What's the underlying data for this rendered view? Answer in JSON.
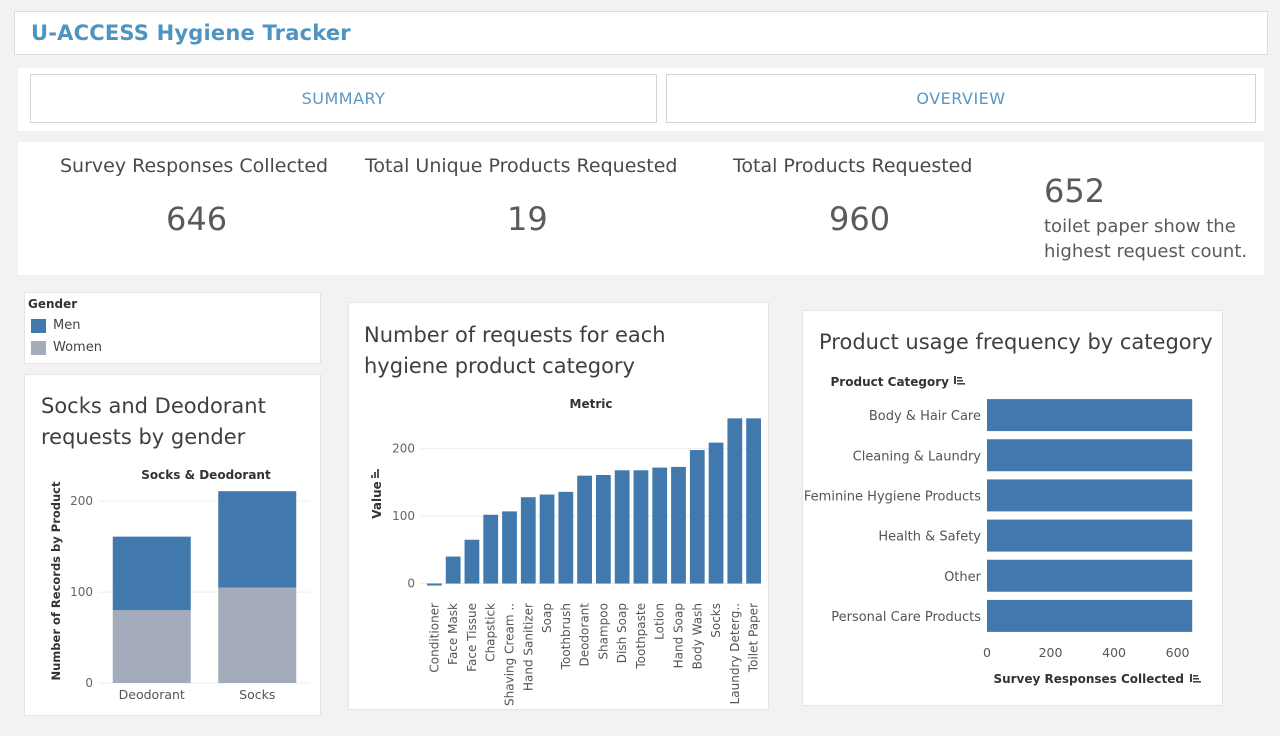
{
  "app": {
    "title": "U-ACCESS Hygiene Tracker"
  },
  "nav": {
    "summary": "SUMMARY",
    "overview": "OVERVIEW"
  },
  "kpis": {
    "survey_label": "Survey Responses Collected",
    "survey_value": "646",
    "unique_label": "Total Unique Products Requested",
    "unique_value": "19",
    "total_label": "Total Products Requested",
    "total_value": "960",
    "note_value": "652",
    "note_text": "toilet paper show the highest request count."
  },
  "legend": {
    "title": "Gender",
    "items": [
      {
        "label": "Men",
        "color": "#4279ad"
      },
      {
        "label": "Women",
        "color": "#a4abba"
      }
    ]
  },
  "charts": {
    "socks": {
      "title": "Socks and Deodorant requests by gender"
    },
    "requests": {
      "title": "Number of requests for each hygiene product category"
    },
    "usage": {
      "title": "Product usage frequency by category"
    }
  },
  "chart_data": [
    {
      "type": "bar",
      "stacked": true,
      "title": "Socks & Deodorant",
      "xlabel": "",
      "ylabel": "Number of Records by Product",
      "categories": [
        "Deodorant",
        "Socks"
      ],
      "series": [
        {
          "name": "Women",
          "values": [
            80,
            105
          ],
          "color": "#a4abba"
        },
        {
          "name": "Men",
          "values": [
            81,
            106
          ],
          "color": "#4279ad"
        }
      ],
      "ylim": [
        0,
        220
      ],
      "yticks": [
        0,
        100,
        200
      ]
    },
    {
      "type": "bar",
      "title": "Metric",
      "ylabel": "Value",
      "categories": [
        "Conditioner",
        "Face Mask",
        "Face Tissue",
        "Chapstick",
        "Shaving Cream ..",
        "Hand Sanitizer",
        "Soap",
        "Toothbrush",
        "Deodorant",
        "Shampoo",
        "Dish Soap",
        "Toothpaste",
        "Lotion",
        "Hand Soap",
        "Body Wash",
        "Socks",
        "Laundry Deterg..",
        "Toilet Paper"
      ],
      "values": [
        -3,
        40,
        65,
        102,
        107,
        128,
        132,
        136,
        160,
        161,
        168,
        168,
        172,
        173,
        198,
        209,
        245,
        245
      ],
      "color": "#4279ad",
      "ylim": [
        -20,
        250
      ],
      "yticks": [
        0,
        100,
        200
      ]
    },
    {
      "type": "bar",
      "orientation": "horizontal",
      "ylabel": "Product Category",
      "xlabel": "Survey Responses Collected",
      "categories": [
        "Body & Hair Care",
        "Cleaning & Laundry",
        "Feminine Hygiene Products",
        "Health & Safety",
        "Other",
        "Personal Care Products"
      ],
      "values": [
        646,
        646,
        646,
        646,
        646,
        646
      ],
      "color": "#4279ad",
      "xlim": [
        0,
        680
      ],
      "xticks": [
        0,
        200,
        400,
        600
      ]
    }
  ]
}
